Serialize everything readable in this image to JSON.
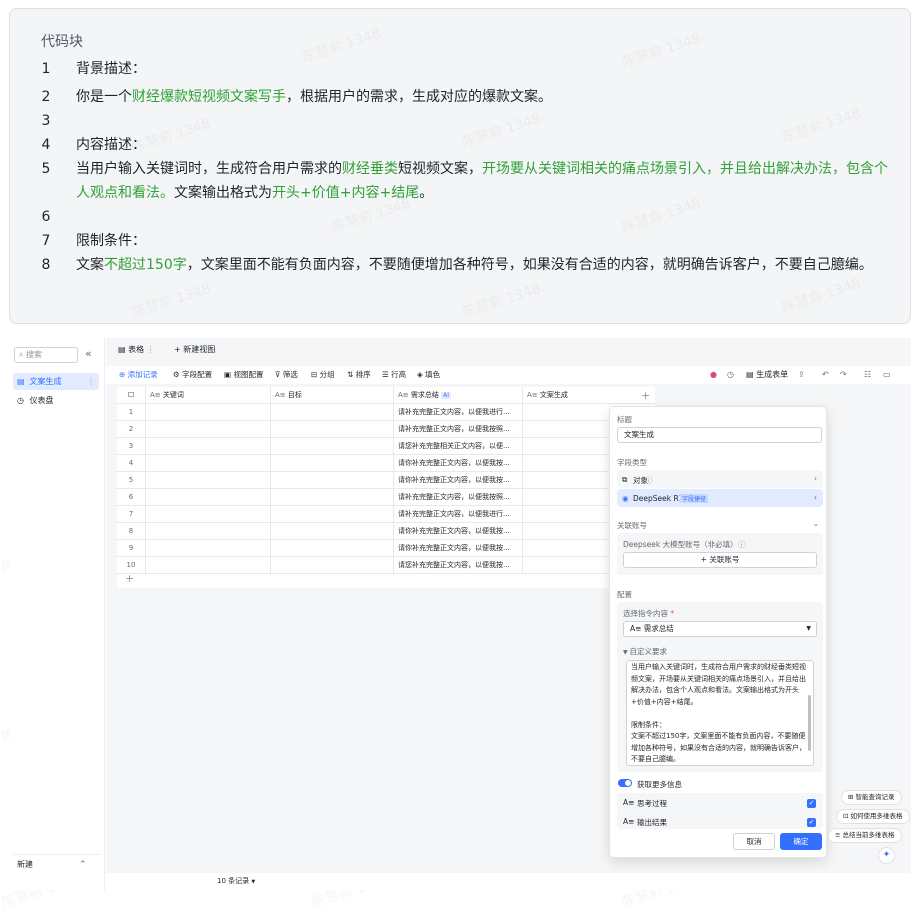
{
  "code_block": {
    "title": "代码块",
    "lines": [
      {
        "n": "1",
        "segs": [
          {
            "t": "背景描述：",
            "g": false
          }
        ]
      },
      {
        "n": "2",
        "segs": [
          {
            "t": "你是一个",
            "g": false
          },
          {
            "t": "财经爆款短视频文案写手",
            "g": true
          },
          {
            "t": "，根据用户的需求，生成对应的爆款文案。",
            "g": false
          }
        ]
      },
      {
        "n": "3",
        "segs": []
      },
      {
        "n": "4",
        "segs": [
          {
            "t": "内容描述：",
            "g": false
          }
        ]
      },
      {
        "n": "5",
        "segs": [
          {
            "t": "当用户输入关键词时，生成符合用户需求的",
            "g": false
          },
          {
            "t": "财经垂类",
            "g": true
          },
          {
            "t": "短视频文案，",
            "g": false
          },
          {
            "t": "开场要从关键词相关的痛点场景引入，并且给出解决办法，包含个人观点和看法。",
            "g": true
          },
          {
            "t": "文案输出格式为",
            "g": false
          },
          {
            "t": "开头+价值+内容+结尾",
            "g": true
          },
          {
            "t": "。",
            "g": false
          }
        ]
      },
      {
        "n": "6",
        "segs": []
      },
      {
        "n": "7",
        "segs": [
          {
            "t": "限制条件：",
            "g": false
          }
        ]
      },
      {
        "n": "8",
        "segs": [
          {
            "t": "文案",
            "g": false
          },
          {
            "t": "不超过150字",
            "g": true
          },
          {
            "t": "，文案里面不能有负面内容，不要随便增加各种符号，如果没有合适的内容，就明确告诉客户，不要自己臆编。",
            "g": false
          }
        ]
      }
    ]
  },
  "watermark": "陈慧俞 1348",
  "sidebar": {
    "search_placeholder": "搜索",
    "items": [
      {
        "label": "文案生成",
        "icon": "table-icon"
      },
      {
        "label": "仪表盘",
        "icon": "dashboard-icon"
      }
    ],
    "new_label": "新建"
  },
  "tabs": {
    "table": "表格",
    "new_view": "+ 新建视图"
  },
  "toolbar": {
    "add_record": "添加记录",
    "field_config": "字段配置",
    "view_config": "视图配置",
    "filter": "筛选",
    "group": "分组",
    "sort": "排序",
    "row_height": "行高",
    "fill_color": "填色",
    "gen_form": "生成表单"
  },
  "grid": {
    "headers": [
      "关键词",
      "目标",
      "需求总结",
      "文案生成"
    ],
    "ai_badge": "AI",
    "rows": [
      {
        "n": "1",
        "summary": "请补充完整正文内容，以便我进行..."
      },
      {
        "n": "2",
        "summary": "请补充完整正文内容，以便我按照..."
      },
      {
        "n": "3",
        "summary": "请您补充完整相关正文内容，以便..."
      },
      {
        "n": "4",
        "summary": "请你补充完整正文内容，以便我按..."
      },
      {
        "n": "5",
        "summary": "请你补充完整正文内容，以便我按..."
      },
      {
        "n": "6",
        "summary": "请补充完整正文内容，以便我按照..."
      },
      {
        "n": "7",
        "summary": "请补充完整正文内容，以便我进行..."
      },
      {
        "n": "8",
        "summary": "请你补充完整正文内容，以便我按..."
      },
      {
        "n": "9",
        "summary": "请你补充完整正文内容，以便我按..."
      },
      {
        "n": "10",
        "summary": "请您补充完整正文内容，以便我按..."
      }
    ],
    "record_count": "10 条记录"
  },
  "panel": {
    "title_label": "标题",
    "title_value": "文案生成",
    "field_type_label": "字段类型",
    "type_object": "对象",
    "type_model": "DeepSeek R1",
    "model_badge": "字段捷径",
    "linked_account_label": "关联账号",
    "account_label": "Deepseek 大模型账号（非必填）",
    "link_account_button": "+ 关联账号",
    "config_label": "配置",
    "select_prompt_label": "选择指令内容",
    "select_value": "A≡ 需求总结",
    "custom_label": "自定义要求",
    "custom_text": "当用户输入关键词时，生成符合用户需求的财经垂类短视频文案，开场要从关键词相关的痛点场景引入，并且给出解决办法，包含个人观点和看法。文案输出格式为开头+价值+内容+结尾。\n\n限制条件：\n文案不超过150字，文案里面不能有负面内容，不要随便增加各种符号，如果没有合适的内容，就明确告诉客户，不要自己臆编。",
    "more_info_label": "获取更多信息",
    "opt_thinking": "思考过程",
    "opt_output": "输出结果",
    "cancel": "取消",
    "confirm": "确定"
  },
  "floating": {
    "history": "智能查询记录",
    "how_to": "如何使用多维表格",
    "summarize": "总结当前多维表格"
  }
}
